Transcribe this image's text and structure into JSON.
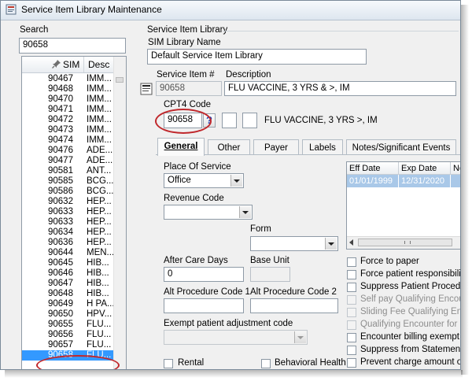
{
  "window": {
    "title": "Service Item Library Maintenance"
  },
  "search": {
    "label": "Search",
    "value": "90658"
  },
  "list": {
    "col_sim": "SIM",
    "col_desc": "Desc",
    "rows": [
      {
        "sim": "90467",
        "desc": "IMM..."
      },
      {
        "sim": "90468",
        "desc": "IMM..."
      },
      {
        "sim": "90470",
        "desc": "IMM..."
      },
      {
        "sim": "90471",
        "desc": "IMM..."
      },
      {
        "sim": "90472",
        "desc": "IMM..."
      },
      {
        "sim": "90473",
        "desc": "IMM..."
      },
      {
        "sim": "90474",
        "desc": "IMM..."
      },
      {
        "sim": "90476",
        "desc": "ADE..."
      },
      {
        "sim": "90477",
        "desc": "ADE..."
      },
      {
        "sim": "90581",
        "desc": "ANT..."
      },
      {
        "sim": "90585",
        "desc": "BCG..."
      },
      {
        "sim": "90586",
        "desc": "BCG..."
      },
      {
        "sim": "90632",
        "desc": "HEP..."
      },
      {
        "sim": "90633",
        "desc": "HEP..."
      },
      {
        "sim": "90633",
        "desc": "HEP..."
      },
      {
        "sim": "90634",
        "desc": "HEP..."
      },
      {
        "sim": "90636",
        "desc": "HEP..."
      },
      {
        "sim": "90644",
        "desc": "MEN..."
      },
      {
        "sim": "90645",
        "desc": "HIB..."
      },
      {
        "sim": "90646",
        "desc": "HIB..."
      },
      {
        "sim": "90647",
        "desc": "HIB..."
      },
      {
        "sim": "90648",
        "desc": "HIB..."
      },
      {
        "sim": "90649",
        "desc": "H PA..."
      },
      {
        "sim": "90650",
        "desc": "HPV..."
      },
      {
        "sim": "90655",
        "desc": "FLU..."
      },
      {
        "sim": "90656",
        "desc": "FLU..."
      },
      {
        "sim": "90657",
        "desc": "FLU..."
      },
      {
        "sim": "90658",
        "desc": "FLU..."
      }
    ],
    "selected_index": 27
  },
  "library": {
    "group_label": "Service Item Library",
    "name_label": "SIM Library Name",
    "name_value": "Default Service Item Library"
  },
  "item": {
    "number_label": "Service Item #",
    "number_value": "90658",
    "desc_label": "Description",
    "desc_value": "FLU VACCINE, 3 YRS & >, IM"
  },
  "cpt": {
    "label": "CPT4 Code",
    "value": "90658",
    "help": "?",
    "description": "FLU VACCINE, 3 YRS  >, IM"
  },
  "tabs": [
    {
      "label": "General",
      "active": true
    },
    {
      "label": "Other",
      "active": false
    },
    {
      "label": "Payer",
      "active": false
    },
    {
      "label": "Labels",
      "active": false
    },
    {
      "label": "Notes/Significant Events",
      "active": false
    }
  ],
  "general": {
    "place_of_service_label": "Place Of Service",
    "place_of_service_value": "Office",
    "revenue_code_label": "Revenue Code",
    "revenue_code_value": "",
    "form_label": "Form",
    "form_value": "",
    "after_care_days_label": "After Care Days",
    "after_care_days_value": "0",
    "base_unit_label": "Base Unit",
    "base_unit_value": "",
    "alt_proc_1_label": "Alt Procedure Code 1",
    "alt_proc_2_label": "Alt Procedure Code 2",
    "exempt_label": "Exempt patient adjustment code",
    "rental_label": "Rental",
    "behavioral_label": "Behavioral Health"
  },
  "fee_grid": {
    "columns": [
      "Eff Date",
      "Exp Date",
      "No"
    ],
    "rows": [
      [
        "01/01/1999",
        "12/31/2020",
        ""
      ]
    ]
  },
  "checkboxes": [
    {
      "label": "Force to paper",
      "enabled": true
    },
    {
      "label": "Force patient responsibility",
      "enabled": true
    },
    {
      "label": "Suppress Patient Procedure",
      "enabled": true
    },
    {
      "label": "Self pay Qualifying Encount",
      "enabled": false
    },
    {
      "label": "Sliding Fee Qualifying Enco",
      "enabled": false
    },
    {
      "label": "Qualifying Encounter for all",
      "enabled": false
    },
    {
      "label": "Encounter billing exempt",
      "enabled": true
    },
    {
      "label": "Suppress from Statement",
      "enabled": true
    },
    {
      "label": "Prevent charge amount ove",
      "enabled": true
    }
  ],
  "colors": {
    "selection": "#3399ff",
    "annotation": "#c0282c",
    "grid_selection": "#a9c8e8"
  }
}
